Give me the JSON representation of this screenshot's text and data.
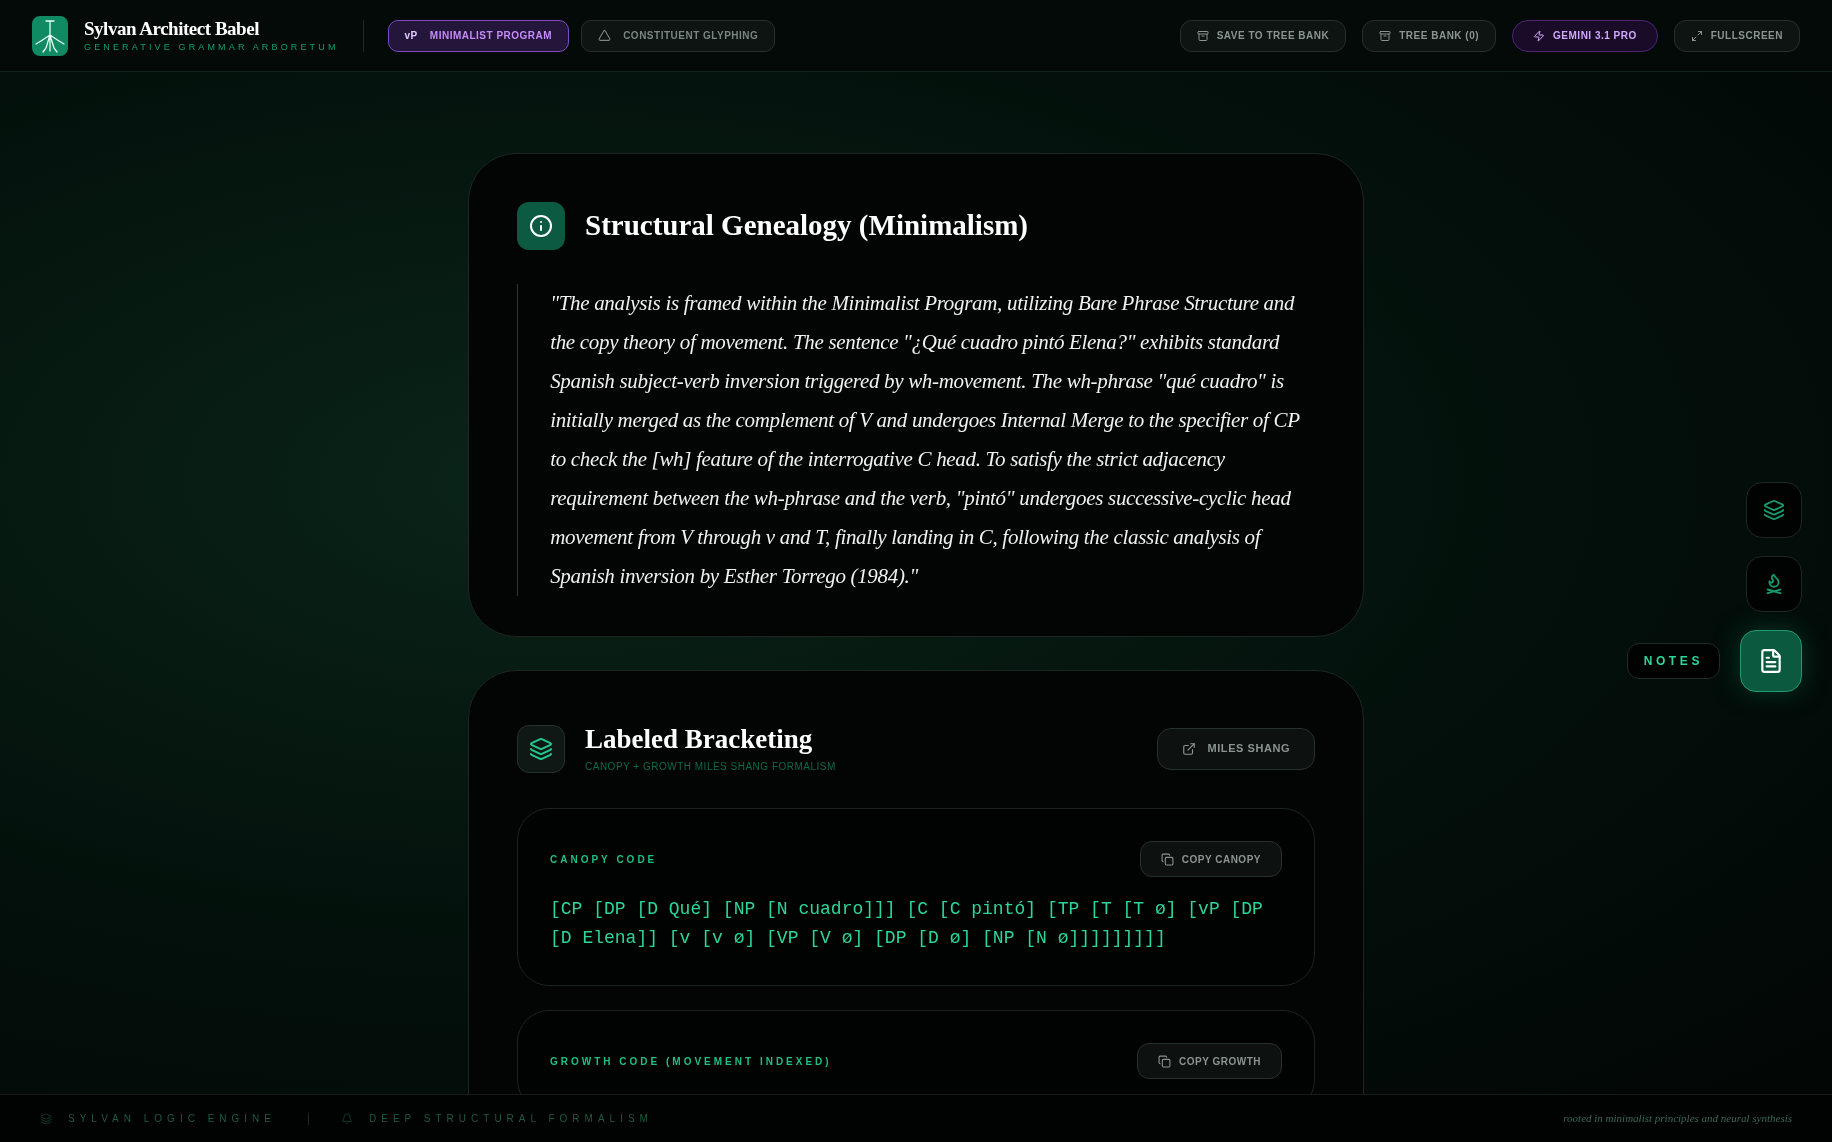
{
  "header": {
    "title": "Sylvan Architect Babel",
    "subtitle": "GENERATIVE GRAMMAR ARBORETUM",
    "modes": [
      {
        "kind": "badge",
        "badge": "vP",
        "label": "MINIMALIST PROGRAM",
        "selected": true
      },
      {
        "kind": "triangle",
        "label": "CONSTITUENT GLYPHING",
        "selected": false
      }
    ],
    "actions": [
      {
        "kind": "archive",
        "label": "SAVE TO TREE BANK"
      },
      {
        "kind": "archive",
        "label": "TREE BANK (0)"
      },
      {
        "kind": "model",
        "label": "GEMINI 3.1 PRO"
      },
      {
        "kind": "expand",
        "label": "FULLSCREEN"
      }
    ]
  },
  "genealogy": {
    "title": "Structural Genealogy (Minimalism)",
    "quote": "\"The analysis is framed within the Minimalist Program, utilizing Bare Phrase Structure and the copy theory of movement. The sentence \"¿Qué cuadro pintó Elena?\" exhibits standard Spanish subject-verb inversion triggered by wh-movement. The wh-phrase \"qué cuadro\" is initially merged as the complement of V and undergoes Internal Merge to the specifier of CP to check the [wh] feature of the interrogative C head. To satisfy the strict adjacency requirement between the wh-phrase and the verb, \"pintó\" undergoes successive-cyclic head movement from V through v and T, finally landing in C, following the classic analysis of Spanish inversion by Esther Torrego (1984).\""
  },
  "bracketing": {
    "title": "Labeled Bracketing",
    "subtitle": "CANOPY + GROWTH MILES SHANG FORMALISM",
    "link": "MILES SHANG",
    "blocks": [
      {
        "label": "CANOPY CODE",
        "button": "COPY CANOPY",
        "code": "[CP [DP [D Qué] [NP [N cuadro]]] [C [C pintó] [TP [T [T ø] [vP [DP [D Elena]] [v [v ø] [VP [V ø] [DP [D ø] [NP [N ø]]]]]]]]]"
      },
      {
        "label": "GROWTH CODE (MOVEMENT INDEXED)",
        "button": "COPY GROWTH"
      }
    ]
  },
  "side_tools": [
    {
      "kind": "layers",
      "selected": false
    },
    {
      "kind": "campfire",
      "selected": false
    },
    {
      "kind": "notes",
      "selected": true,
      "tooltip": "NOTES"
    }
  ],
  "footer": {
    "items": [
      {
        "kind": "layers",
        "label": "SYLVAN LOGIC ENGINE"
      },
      {
        "kind": "bell",
        "label": "DEEP STRUCTURAL FORMALISM"
      }
    ],
    "note": "rooted in minimalist principles and neural synthesis"
  }
}
